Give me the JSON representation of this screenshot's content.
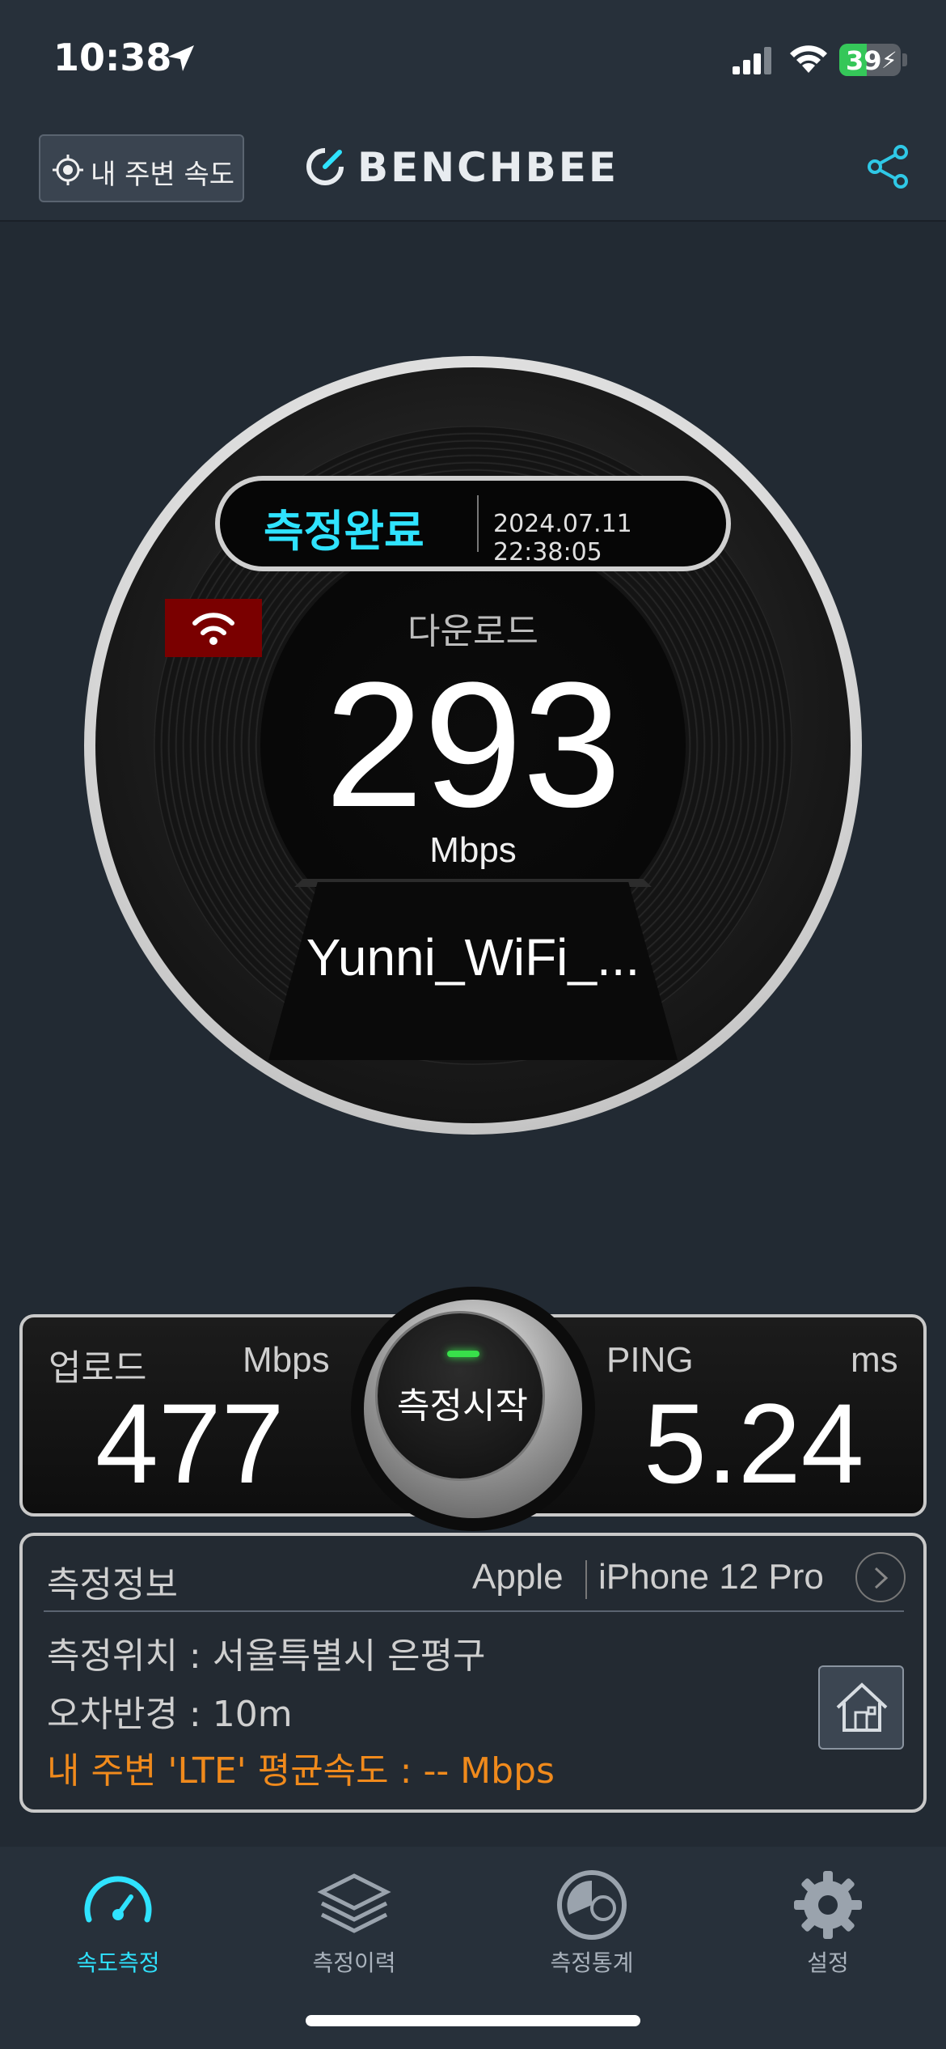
{
  "status_bar": {
    "time": "10:38",
    "battery": "39"
  },
  "header": {
    "nearby_button": "내 주변 속도",
    "logo": "BENCHBEE"
  },
  "gauge": {
    "status": "측정완료",
    "timestamp": "2024.07.11 22:38:05",
    "label": "다운로드",
    "value": "293",
    "unit": "Mbps",
    "network": "Yunni_WiFi_..."
  },
  "results": {
    "upload_label": "업로드",
    "upload_unit": "Mbps",
    "upload_value": "477",
    "ping_label": "PING",
    "ping_unit": "ms",
    "ping_value": "5.24",
    "start_button": "측정시작"
  },
  "info": {
    "title": "측정정보",
    "brand": "Apple",
    "model": "iPhone 12 Pro",
    "location": "측정위치 : 서울특별시 은평구",
    "error_radius": "오차반경 : 10m",
    "nearby_avg": "내 주변 'LTE' 평균속도 : -- Mbps"
  },
  "tabs": [
    {
      "label": "속도측정",
      "icon": "speedometer-icon",
      "active": true
    },
    {
      "label": "측정이력",
      "icon": "layers-icon",
      "active": false
    },
    {
      "label": "측정통계",
      "icon": "statistics-icon",
      "active": false
    },
    {
      "label": "설정",
      "icon": "gear-icon",
      "active": false
    }
  ],
  "colors": {
    "accent": "#2fe3ff",
    "warning": "#f08a1c",
    "background": "#222a33",
    "wifi_badge": "#7a0000"
  }
}
